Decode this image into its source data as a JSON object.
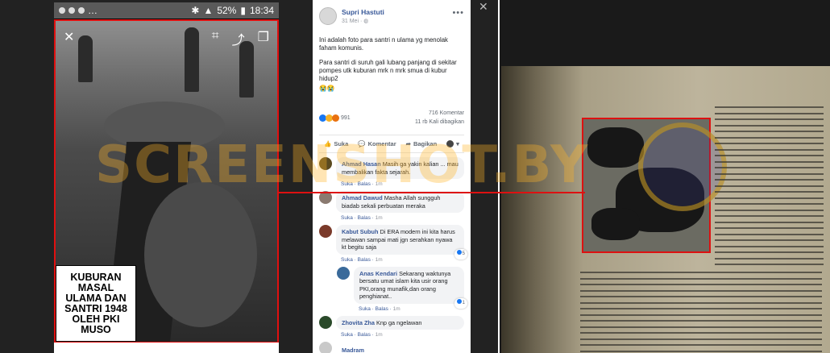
{
  "phone": {
    "status_left": "…",
    "battery": "52%",
    "time": "18:34",
    "caption_lines": [
      "KUBURAN",
      "MASAL",
      "ULAMA DAN",
      "SANTRI 1948",
      "OLEH PKI",
      "MUSO"
    ]
  },
  "watermark": "SCREENSHOT.BY",
  "post": {
    "author": "Supri Hastuti",
    "date": "31 Mei",
    "paragraphs": [
      "Ini adalah foto para santri n ulama yg menolak faham komunis.",
      "Para santri di suruh gali lubang panjang di sekitar pompes utk kuburan mrk n mrk smua di kubur hidup2",
      "😭😭"
    ],
    "reaction_count": "991",
    "comments_count": "716 Komentar",
    "shares_count": "11 rb Kali dibagikan",
    "actions": {
      "like": "Suka",
      "comment": "Komentar",
      "share": "Bagikan"
    }
  },
  "comments": [
    {
      "name": "Ahmad Hasan",
      "text": "Masih ga yakin kalian ... mau membalikan fakta sejarah.",
      "like": "Suka",
      "reply": "Balas",
      "time": "1m",
      "likes": ""
    },
    {
      "name": "Ahmad Dawud",
      "text": "Masha Allah sungguh biadab sekali perbuatan meraka",
      "like": "Suka",
      "reply": "Balas",
      "time": "1m",
      "likes": ""
    },
    {
      "name": "Kabut Subuh",
      "text": "Di ERA modern ini kita harus melawan sampai mati jgn serahkan nyawa kt begitu saja",
      "like": "Suka",
      "reply": "Balas",
      "time": "1m",
      "likes": "5"
    },
    {
      "name": "Anas Kendari",
      "text": "Sekarang waktunya bersatu umat islam kita usir orang PKI,orang munafik,dan orang penghianat..",
      "like": "Suka",
      "reply": "Balas",
      "time": "1m",
      "likes": "1"
    },
    {
      "name": "Zhovita Zha",
      "text": "Knp ga ngelawan",
      "like": "Suka",
      "reply": "Balas",
      "time": "1m",
      "likes": ""
    },
    {
      "name": "Madram",
      "text": "",
      "like": "",
      "reply": "",
      "time": "",
      "likes": ""
    }
  ],
  "colors": {
    "link": "#385898",
    "highlight": "#e01010",
    "watermark": "#ffb428"
  }
}
